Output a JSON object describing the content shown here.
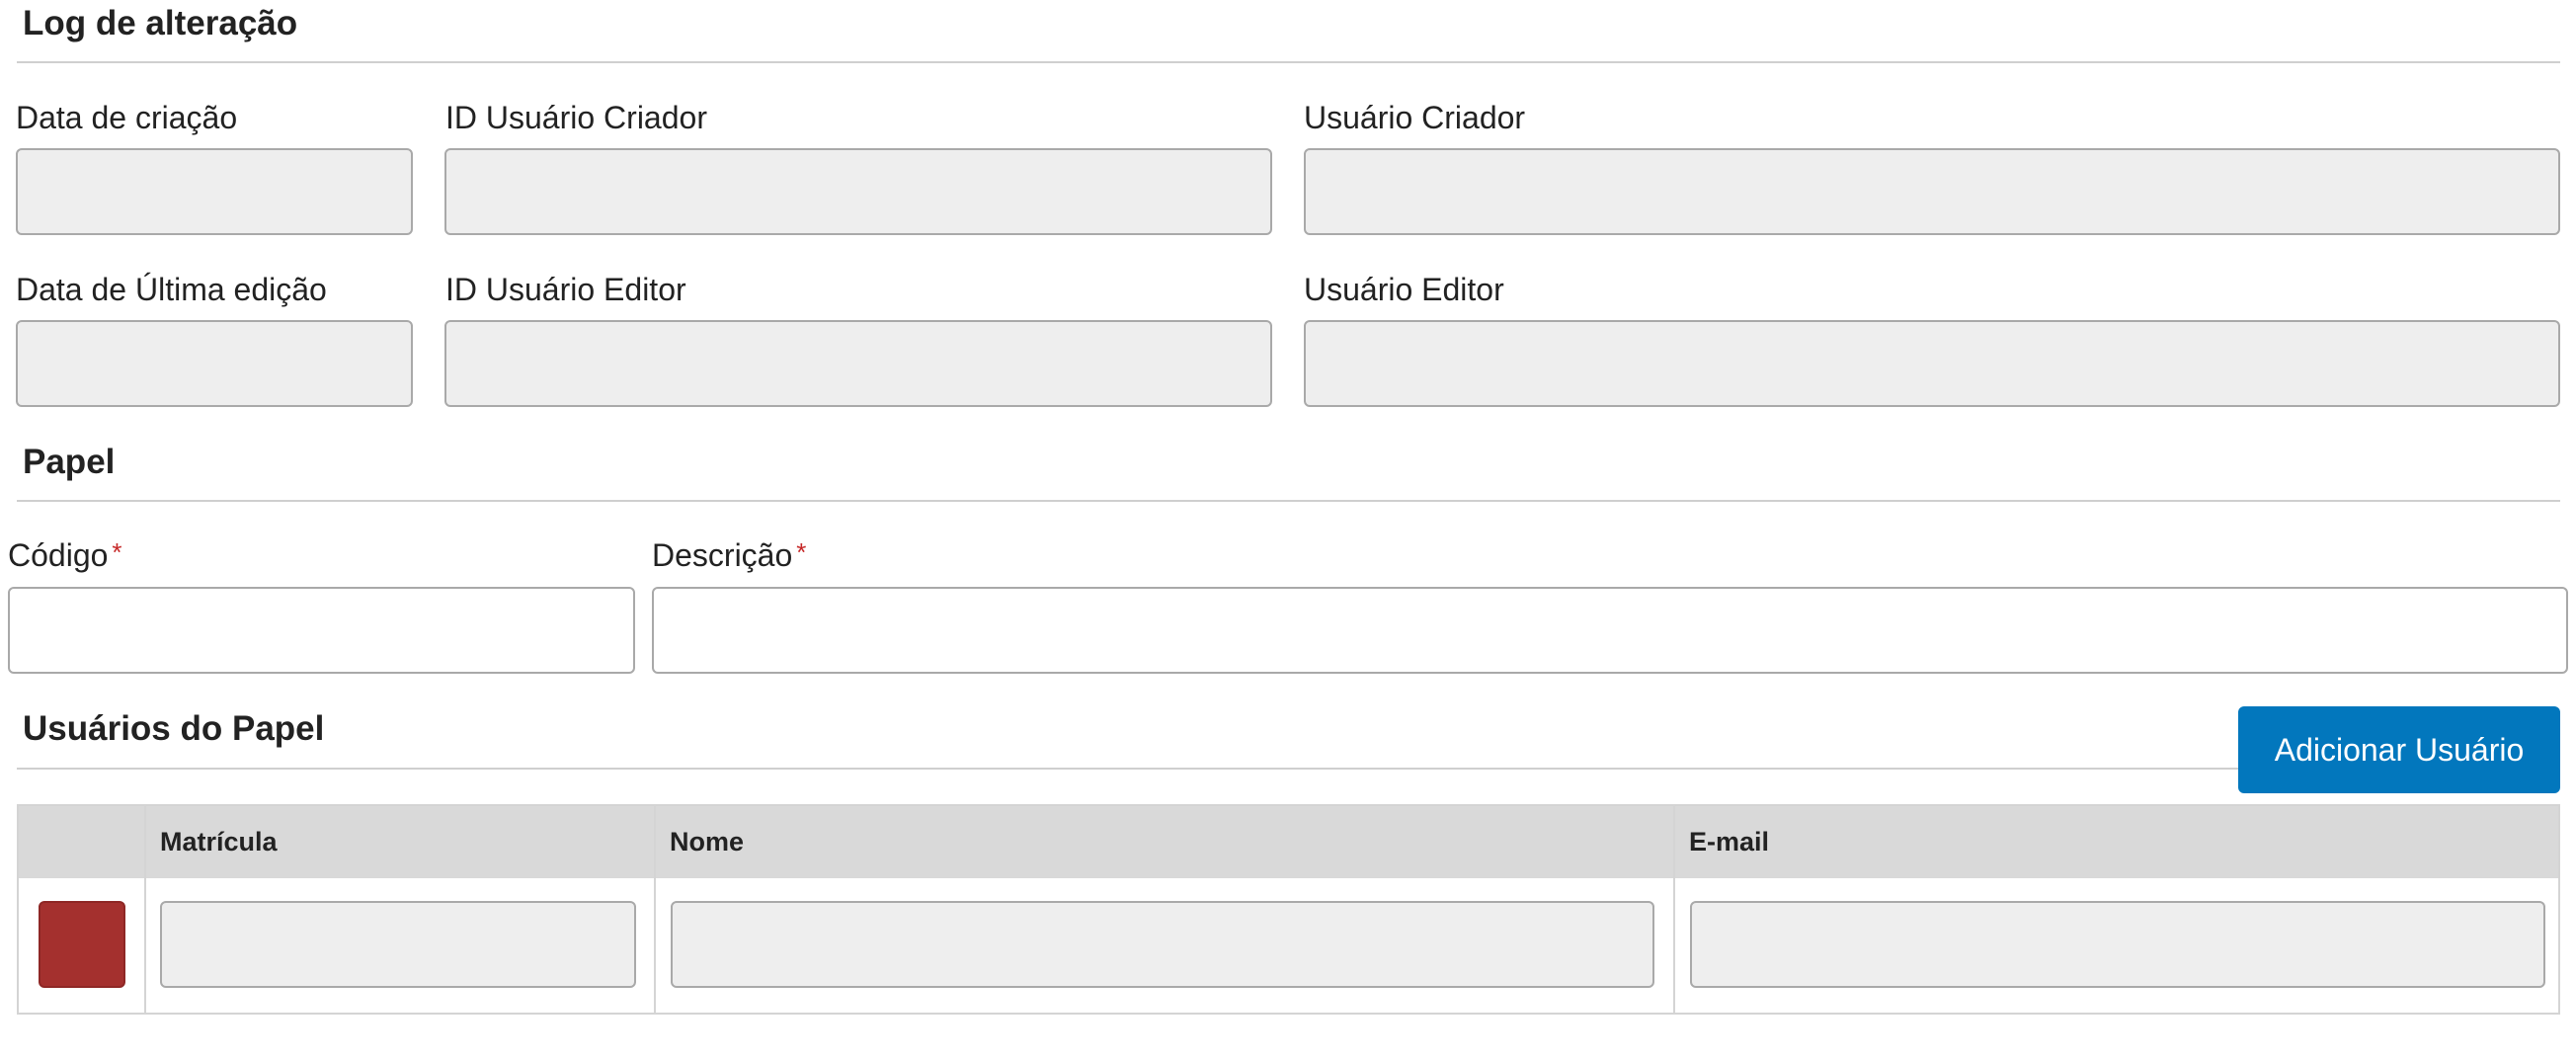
{
  "log_section": {
    "title": "Log de alteração",
    "fields": {
      "data_criacao": {
        "label": "Data de criação",
        "value": ""
      },
      "id_usuario_criador": {
        "label": "ID Usuário Criador",
        "value": ""
      },
      "usuario_criador": {
        "label": "Usuário Criador",
        "value": ""
      },
      "data_ultima_edicao": {
        "label": "Data de Última edição",
        "value": ""
      },
      "id_usuario_editor": {
        "label": "ID Usuário Editor",
        "value": ""
      },
      "usuario_editor": {
        "label": "Usuário Editor",
        "value": ""
      }
    }
  },
  "papel_section": {
    "title": "Papel",
    "required_marker": "*",
    "fields": {
      "codigo": {
        "label": "Código",
        "value": "",
        "required": true
      },
      "descricao": {
        "label": "Descrição",
        "value": "",
        "required": true
      }
    }
  },
  "usuarios_section": {
    "title": "Usuários do Papel",
    "add_button_label": "Adicionar Usuário",
    "table": {
      "columns": [
        "",
        "Matrícula",
        "Nome",
        "E-mail"
      ],
      "rows": [
        {
          "matricula": "",
          "nome": "",
          "email": ""
        }
      ]
    }
  },
  "colors": {
    "primary_button": "#0277bd",
    "delete_button": "#a4302e",
    "required_marker": "#c62828",
    "readonly_field_bg": "#eeeeee",
    "table_header_bg": "#d9d9d9"
  },
  "icons": {
    "row_action": "delete-row-icon"
  }
}
